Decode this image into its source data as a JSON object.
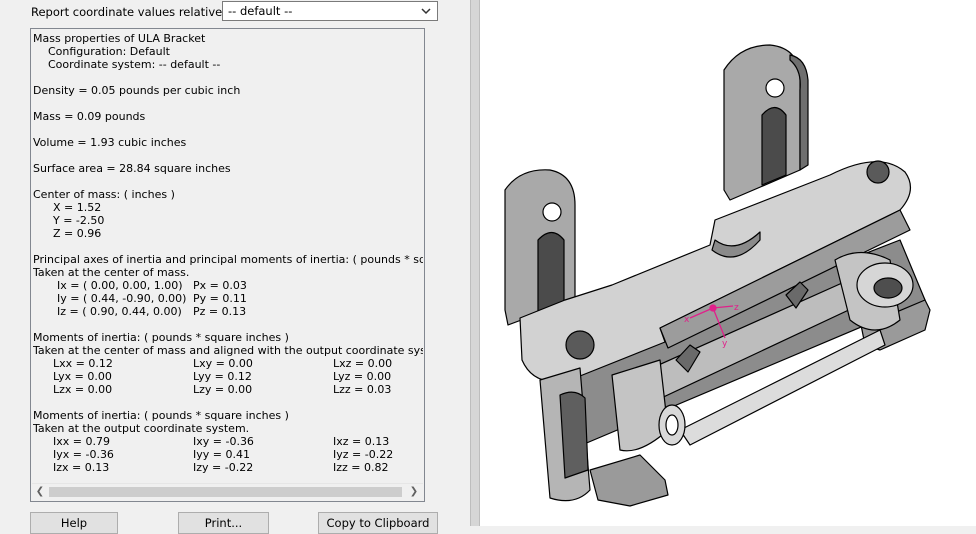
{
  "header": {
    "coord_label": "Report coordinate values relative to:",
    "coord_value": "-- default --"
  },
  "results": {
    "title": "Mass properties of ULA Bracket",
    "configuration": "Configuration: Default",
    "coord_system": "Coordinate system: -- default --",
    "density": "Density = 0.05 pounds per cubic inch",
    "mass": "Mass = 0.09 pounds",
    "volume": "Volume = 1.93 cubic inches",
    "surface_area": "Surface area = 28.84 square inches",
    "com_header": "Center of mass: ( inches )",
    "com_x": "X = 1.52",
    "com_y": "Y = -2.50",
    "com_z": "Z = 0.96",
    "principal_header": "Principal axes of inertia and principal moments of inertia: ( pounds * square",
    "principal_sub": "Taken at the center of mass.",
    "principal_rows": [
      {
        "axis": "Ix = ( 0.00,  0.00,  1.00)",
        "moment": "Px = 0.03"
      },
      {
        "axis": "Iy = ( 0.44, -0.90,  0.00)",
        "moment": "Py = 0.11"
      },
      {
        "axis": "Iz = ( 0.90,  0.44,  0.00)",
        "moment": "Pz = 0.13"
      }
    ],
    "moi_com_header": "Moments of inertia: ( pounds * square inches )",
    "moi_com_sub": "Taken at the center of mass and aligned with the output coordinate system.",
    "moi_com_rows": [
      [
        "Lxx = 0.12",
        "Lxy = 0.00",
        "Lxz = 0.00"
      ],
      [
        "Lyx = 0.00",
        "Lyy = 0.12",
        "Lyz = 0.00"
      ],
      [
        "Lzx = 0.00",
        "Lzy = 0.00",
        "Lzz = 0.03"
      ]
    ],
    "moi_out_header": "Moments of inertia: ( pounds * square inches )",
    "moi_out_sub": "Taken at the output coordinate system.",
    "moi_out_rows": [
      [
        "Ixx = 0.79",
        "Ixy = -0.36",
        "Ixz = 0.13"
      ],
      [
        "Iyx = -0.36",
        "Iyy = 0.41",
        "Iyz = -0.22"
      ],
      [
        "Izx = 0.13",
        "Izy = -0.22",
        "Izz = 0.82"
      ]
    ]
  },
  "buttons": {
    "help": "Help",
    "print": "Print...",
    "copy": "Copy to Clipboard"
  },
  "viewport": {
    "triad": {
      "x": "x",
      "y": "y",
      "z": "z"
    },
    "colors": {
      "triad": "#e0208a",
      "part_fill": "#c8c8c8",
      "part_dark": "#7a7a7a"
    }
  }
}
